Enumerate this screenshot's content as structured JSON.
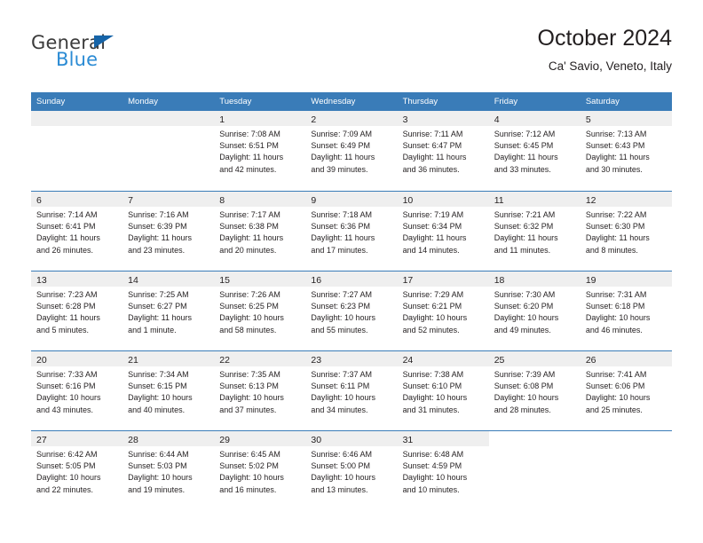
{
  "brand": {
    "word_one": "General",
    "word_two": "Blue",
    "triangle_icon": "brand-triangle-icon",
    "accent_color": "#2b8bd4",
    "logo_dark_color": "#3b3b3b"
  },
  "header": {
    "title": "October 2024",
    "subtitle": "Ca' Savio, Veneto, Italy"
  },
  "calendar": {
    "header_bg_color": "#3a7cb8",
    "daynum_strip_color": "#efefef",
    "weekdays": [
      "Sunday",
      "Monday",
      "Tuesday",
      "Wednesday",
      "Thursday",
      "Friday",
      "Saturday"
    ],
    "weeks": [
      [
        {
          "day": "",
          "lines": []
        },
        {
          "day": "",
          "lines": []
        },
        {
          "day": "1",
          "lines": [
            "Sunrise: 7:08 AM",
            "Sunset: 6:51 PM",
            "Daylight: 11 hours",
            "and 42 minutes."
          ]
        },
        {
          "day": "2",
          "lines": [
            "Sunrise: 7:09 AM",
            "Sunset: 6:49 PM",
            "Daylight: 11 hours",
            "and 39 minutes."
          ]
        },
        {
          "day": "3",
          "lines": [
            "Sunrise: 7:11 AM",
            "Sunset: 6:47 PM",
            "Daylight: 11 hours",
            "and 36 minutes."
          ]
        },
        {
          "day": "4",
          "lines": [
            "Sunrise: 7:12 AM",
            "Sunset: 6:45 PM",
            "Daylight: 11 hours",
            "and 33 minutes."
          ]
        },
        {
          "day": "5",
          "lines": [
            "Sunrise: 7:13 AM",
            "Sunset: 6:43 PM",
            "Daylight: 11 hours",
            "and 30 minutes."
          ]
        }
      ],
      [
        {
          "day": "6",
          "lines": [
            "Sunrise: 7:14 AM",
            "Sunset: 6:41 PM",
            "Daylight: 11 hours",
            "and 26 minutes."
          ]
        },
        {
          "day": "7",
          "lines": [
            "Sunrise: 7:16 AM",
            "Sunset: 6:39 PM",
            "Daylight: 11 hours",
            "and 23 minutes."
          ]
        },
        {
          "day": "8",
          "lines": [
            "Sunrise: 7:17 AM",
            "Sunset: 6:38 PM",
            "Daylight: 11 hours",
            "and 20 minutes."
          ]
        },
        {
          "day": "9",
          "lines": [
            "Sunrise: 7:18 AM",
            "Sunset: 6:36 PM",
            "Daylight: 11 hours",
            "and 17 minutes."
          ]
        },
        {
          "day": "10",
          "lines": [
            "Sunrise: 7:19 AM",
            "Sunset: 6:34 PM",
            "Daylight: 11 hours",
            "and 14 minutes."
          ]
        },
        {
          "day": "11",
          "lines": [
            "Sunrise: 7:21 AM",
            "Sunset: 6:32 PM",
            "Daylight: 11 hours",
            "and 11 minutes."
          ]
        },
        {
          "day": "12",
          "lines": [
            "Sunrise: 7:22 AM",
            "Sunset: 6:30 PM",
            "Daylight: 11 hours",
            "and 8 minutes."
          ]
        }
      ],
      [
        {
          "day": "13",
          "lines": [
            "Sunrise: 7:23 AM",
            "Sunset: 6:28 PM",
            "Daylight: 11 hours",
            "and 5 minutes."
          ]
        },
        {
          "day": "14",
          "lines": [
            "Sunrise: 7:25 AM",
            "Sunset: 6:27 PM",
            "Daylight: 11 hours",
            "and 1 minute."
          ]
        },
        {
          "day": "15",
          "lines": [
            "Sunrise: 7:26 AM",
            "Sunset: 6:25 PM",
            "Daylight: 10 hours",
            "and 58 minutes."
          ]
        },
        {
          "day": "16",
          "lines": [
            "Sunrise: 7:27 AM",
            "Sunset: 6:23 PM",
            "Daylight: 10 hours",
            "and 55 minutes."
          ]
        },
        {
          "day": "17",
          "lines": [
            "Sunrise: 7:29 AM",
            "Sunset: 6:21 PM",
            "Daylight: 10 hours",
            "and 52 minutes."
          ]
        },
        {
          "day": "18",
          "lines": [
            "Sunrise: 7:30 AM",
            "Sunset: 6:20 PM",
            "Daylight: 10 hours",
            "and 49 minutes."
          ]
        },
        {
          "day": "19",
          "lines": [
            "Sunrise: 7:31 AM",
            "Sunset: 6:18 PM",
            "Daylight: 10 hours",
            "and 46 minutes."
          ]
        }
      ],
      [
        {
          "day": "20",
          "lines": [
            "Sunrise: 7:33 AM",
            "Sunset: 6:16 PM",
            "Daylight: 10 hours",
            "and 43 minutes."
          ]
        },
        {
          "day": "21",
          "lines": [
            "Sunrise: 7:34 AM",
            "Sunset: 6:15 PM",
            "Daylight: 10 hours",
            "and 40 minutes."
          ]
        },
        {
          "day": "22",
          "lines": [
            "Sunrise: 7:35 AM",
            "Sunset: 6:13 PM",
            "Daylight: 10 hours",
            "and 37 minutes."
          ]
        },
        {
          "day": "23",
          "lines": [
            "Sunrise: 7:37 AM",
            "Sunset: 6:11 PM",
            "Daylight: 10 hours",
            "and 34 minutes."
          ]
        },
        {
          "day": "24",
          "lines": [
            "Sunrise: 7:38 AM",
            "Sunset: 6:10 PM",
            "Daylight: 10 hours",
            "and 31 minutes."
          ]
        },
        {
          "day": "25",
          "lines": [
            "Sunrise: 7:39 AM",
            "Sunset: 6:08 PM",
            "Daylight: 10 hours",
            "and 28 minutes."
          ]
        },
        {
          "day": "26",
          "lines": [
            "Sunrise: 7:41 AM",
            "Sunset: 6:06 PM",
            "Daylight: 10 hours",
            "and 25 minutes."
          ]
        }
      ],
      [
        {
          "day": "27",
          "lines": [
            "Sunrise: 6:42 AM",
            "Sunset: 5:05 PM",
            "Daylight: 10 hours",
            "and 22 minutes."
          ]
        },
        {
          "day": "28",
          "lines": [
            "Sunrise: 6:44 AM",
            "Sunset: 5:03 PM",
            "Daylight: 10 hours",
            "and 19 minutes."
          ]
        },
        {
          "day": "29",
          "lines": [
            "Sunrise: 6:45 AM",
            "Sunset: 5:02 PM",
            "Daylight: 10 hours",
            "and 16 minutes."
          ]
        },
        {
          "day": "30",
          "lines": [
            "Sunrise: 6:46 AM",
            "Sunset: 5:00 PM",
            "Daylight: 10 hours",
            "and 13 minutes."
          ]
        },
        {
          "day": "31",
          "lines": [
            "Sunrise: 6:48 AM",
            "Sunset: 4:59 PM",
            "Daylight: 10 hours",
            "and 10 minutes."
          ]
        },
        {
          "day": "",
          "lines": []
        },
        {
          "day": "",
          "lines": []
        }
      ]
    ]
  }
}
